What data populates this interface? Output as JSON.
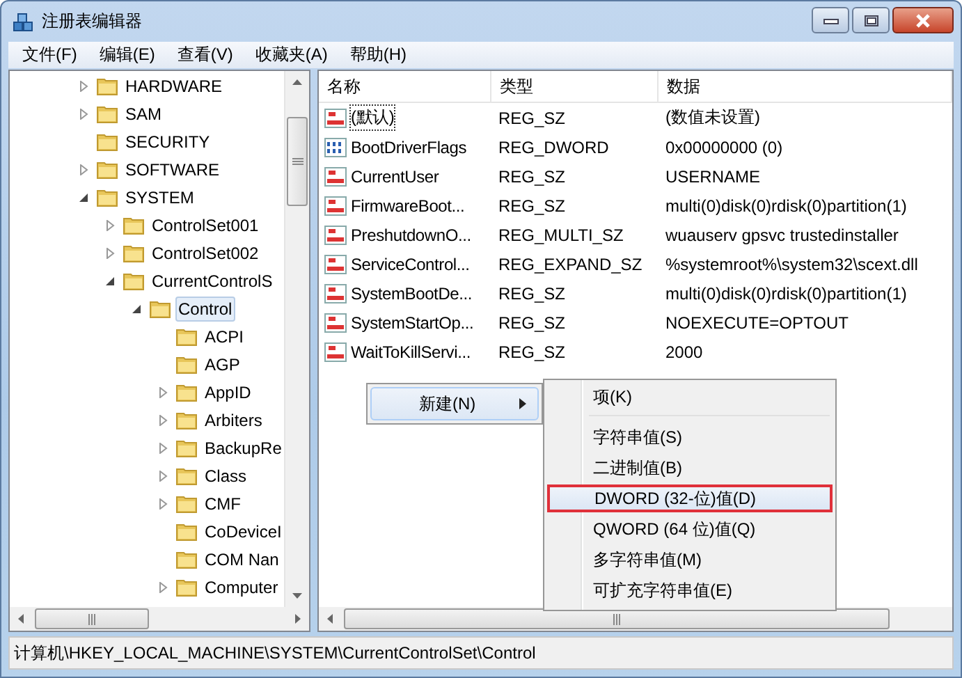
{
  "window": {
    "title": "注册表编辑器"
  },
  "menu_bar": [
    {
      "label": "文件(F)"
    },
    {
      "label": "编辑(E)"
    },
    {
      "label": "查看(V)"
    },
    {
      "label": "收藏夹(A)"
    },
    {
      "label": "帮助(H)"
    }
  ],
  "tree": [
    {
      "label": "HARDWARE",
      "expandable": true,
      "expanded": false,
      "selected": false
    },
    {
      "label": "SAM",
      "expandable": true,
      "expanded": false,
      "selected": false
    },
    {
      "label": "SECURITY",
      "expandable": false,
      "selected": false
    },
    {
      "label": "SOFTWARE",
      "expandable": true,
      "expanded": false,
      "selected": false
    },
    {
      "label": "SYSTEM",
      "expandable": true,
      "expanded": true,
      "selected": false,
      "children": [
        {
          "label": "ControlSet001",
          "expandable": true,
          "expanded": false,
          "selected": false
        },
        {
          "label": "ControlSet002",
          "expandable": true,
          "expanded": false,
          "selected": false
        },
        {
          "label": "CurrentControlS",
          "expandable": true,
          "expanded": true,
          "selected": false,
          "children": [
            {
              "label": "Control",
              "expandable": true,
              "expanded": true,
              "selected": true,
              "children": [
                {
                  "label": "ACPI",
                  "expandable": false,
                  "selected": false
                },
                {
                  "label": "AGP",
                  "expandable": false,
                  "selected": false
                },
                {
                  "label": "AppID",
                  "expandable": true,
                  "expanded": false,
                  "selected": false
                },
                {
                  "label": "Arbiters",
                  "expandable": true,
                  "expanded": false,
                  "selected": false
                },
                {
                  "label": "BackupRe",
                  "expandable": true,
                  "expanded": false,
                  "selected": false
                },
                {
                  "label": "Class",
                  "expandable": true,
                  "expanded": false,
                  "selected": false
                },
                {
                  "label": "CMF",
                  "expandable": true,
                  "expanded": false,
                  "selected": false
                },
                {
                  "label": "CoDeviceI",
                  "expandable": false,
                  "selected": false
                },
                {
                  "label": "COM Nan",
                  "expandable": false,
                  "selected": false
                },
                {
                  "label": "Computer",
                  "expandable": true,
                  "expanded": false,
                  "selected": false
                }
              ]
            }
          ]
        }
      ]
    }
  ],
  "list": {
    "columns": [
      "名称",
      "类型",
      "数据"
    ],
    "rows": [
      {
        "kind": "string",
        "name": "(默认)",
        "type": "REG_SZ",
        "data": "(数值未设置)",
        "focused": true
      },
      {
        "kind": "binary",
        "name": "BootDriverFlags",
        "type": "REG_DWORD",
        "data": "0x00000000 (0)",
        "focused": false
      },
      {
        "kind": "string",
        "name": "CurrentUser",
        "type": "REG_SZ",
        "data": "USERNAME",
        "focused": false
      },
      {
        "kind": "string",
        "name": "FirmwareBoot...",
        "type": "REG_SZ",
        "data": "multi(0)disk(0)rdisk(0)partition(1)",
        "focused": false
      },
      {
        "kind": "string",
        "name": "PreshutdownO...",
        "type": "REG_MULTI_SZ",
        "data": "wuauserv gpsvc trustedinstaller",
        "focused": false
      },
      {
        "kind": "string",
        "name": "ServiceControl...",
        "type": "REG_EXPAND_SZ",
        "data": "%systemroot%\\system32\\scext.dll",
        "focused": false
      },
      {
        "kind": "string",
        "name": "SystemBootDe...",
        "type": "REG_SZ",
        "data": "multi(0)disk(0)rdisk(0)partition(1)",
        "focused": false
      },
      {
        "kind": "string",
        "name": "SystemStartOp...",
        "type": "REG_SZ",
        "data": " NOEXECUTE=OPTOUT",
        "focused": false
      },
      {
        "kind": "string",
        "name": "WaitToKillServi...",
        "type": "REG_SZ",
        "data": "2000",
        "focused": false
      }
    ]
  },
  "context_menu": {
    "items": [
      {
        "label": "新建(N)",
        "selected": true
      }
    ]
  },
  "submenu": {
    "items": [
      {
        "kind": "item",
        "label": "项(K)",
        "selected": false
      },
      {
        "kind": "separator"
      },
      {
        "kind": "item",
        "label": "字符串值(S)",
        "selected": false
      },
      {
        "kind": "item",
        "label": "二进制值(B)",
        "selected": false
      },
      {
        "kind": "item",
        "label": "DWORD (32-位)值(D)",
        "selected": true
      },
      {
        "kind": "item",
        "label": "QWORD (64 位)值(Q)",
        "selected": false
      },
      {
        "kind": "item",
        "label": "多字符串值(M)",
        "selected": false
      },
      {
        "kind": "item",
        "label": "可扩充字符串值(E)",
        "selected": false
      }
    ]
  },
  "status_bar": "计算机\\HKEY_LOCAL_MACHINE\\SYSTEM\\CurrentControlSet\\Control"
}
